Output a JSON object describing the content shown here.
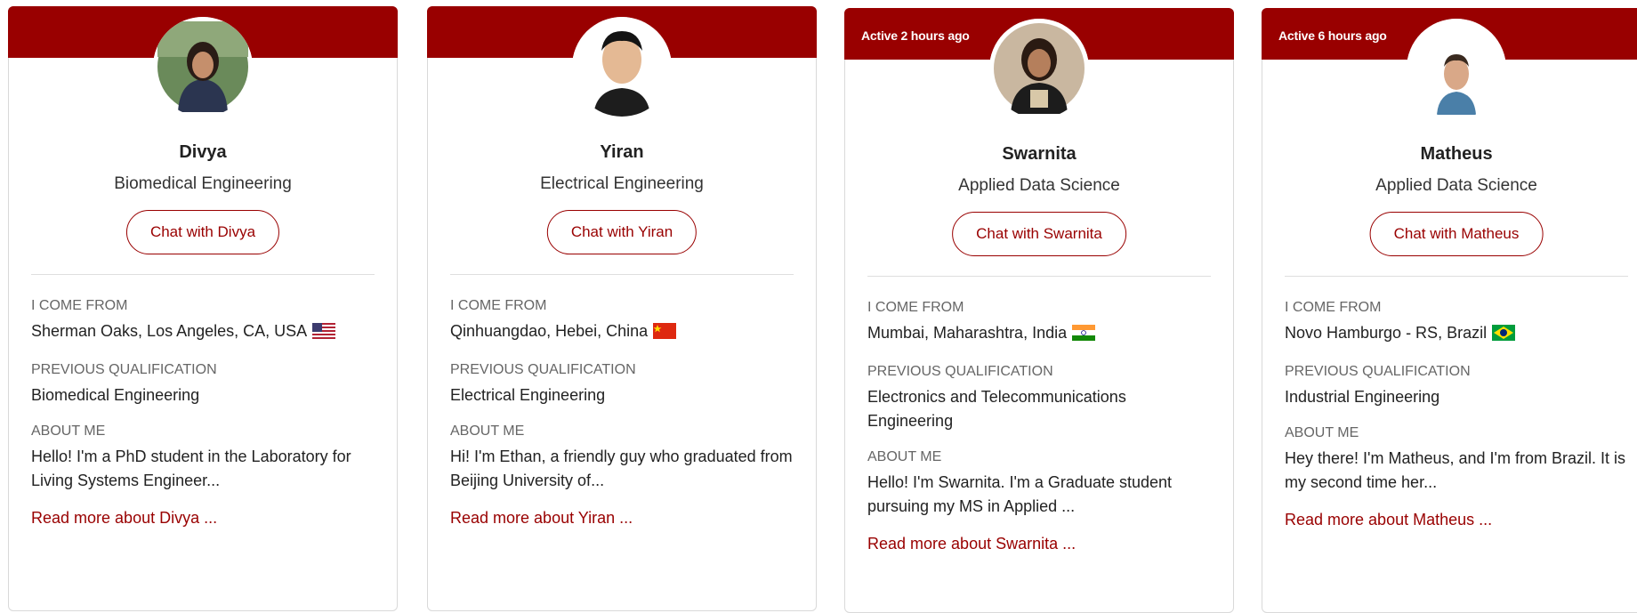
{
  "labels": {
    "come_from": "I COME FROM",
    "qualification": "PREVIOUS QUALIFICATION",
    "about": "ABOUT ME"
  },
  "colors": {
    "accent": "#990000"
  },
  "cards": [
    {
      "active": "",
      "name": "Divya",
      "program": "Biomedical Engineering",
      "chat": "Chat with Divya",
      "from": "Sherman Oaks, Los Angeles, CA, USA",
      "flag": "us-flag-icon",
      "qualification": "Biomedical Engineering",
      "about": "Hello! I'm a PhD student in the Laboratory for Living Systems Engineer...",
      "read_more": "Read more about Divya ..."
    },
    {
      "active": "",
      "name": "Yiran",
      "program": "Electrical Engineering",
      "chat": "Chat with Yiran",
      "from": "Qinhuangdao, Hebei, China",
      "flag": "china-flag-icon",
      "qualification": "Electrical Engineering",
      "about": "Hi! I'm Ethan, a friendly guy who graduated from Beijing University of...",
      "read_more": "Read more about Yiran ..."
    },
    {
      "active": "Active 2 hours ago",
      "name": "Swarnita",
      "program": "Applied Data Science",
      "chat": "Chat with Swarnita",
      "from": "Mumbai, Maharashtra, India",
      "flag": "india-flag-icon",
      "qualification": "Electronics and Telecommunications Engineering",
      "about": "Hello! I'm Swarnita. I'm a Graduate student pursuing my MS in Applied ...",
      "read_more": "Read more about Swarnita ..."
    },
    {
      "active": "Active 6 hours ago",
      "name": "Matheus",
      "program": "Applied Data Science",
      "chat": "Chat with Matheus",
      "from": "Novo Hamburgo - RS, Brazil",
      "flag": "brazil-flag-icon",
      "qualification": "Industrial Engineering",
      "about": "Hey there! I'm Matheus, and I'm from Brazil. It is my second time her...",
      "read_more": "Read more about Matheus ..."
    }
  ]
}
